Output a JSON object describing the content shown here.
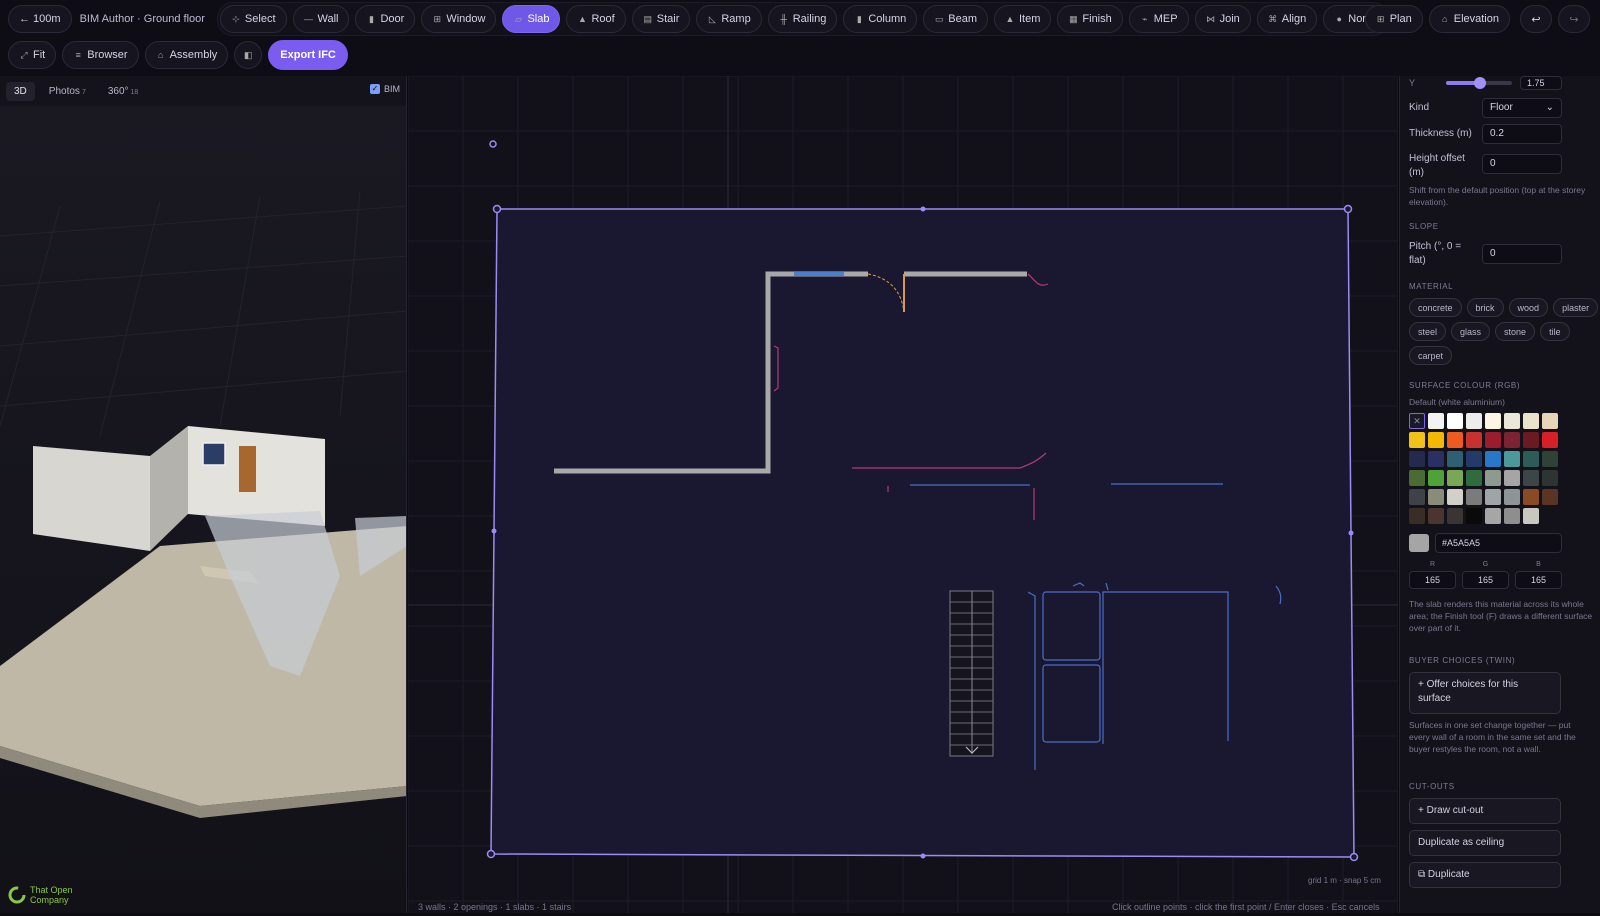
{
  "toolbar": {
    "back_label": "← 100m",
    "title": "BIM Author · Ground floor",
    "tools": [
      {
        "icon": "⊹",
        "label": "Select"
      },
      {
        "icon": "—",
        "label": "Wall"
      },
      {
        "icon": "▮",
        "label": "Door"
      },
      {
        "icon": "⊞",
        "label": "Window"
      },
      {
        "icon": "▱",
        "label": "Slab"
      },
      {
        "icon": "▲",
        "label": "Roof"
      },
      {
        "icon": "▤",
        "label": "Stair"
      },
      {
        "icon": "◺",
        "label": "Ramp"
      },
      {
        "icon": "╫",
        "label": "Railing"
      },
      {
        "icon": "▮",
        "label": "Column"
      },
      {
        "icon": "▭",
        "label": "Beam"
      },
      {
        "icon": "▲",
        "label": "Item"
      },
      {
        "icon": "▦",
        "label": "Finish"
      },
      {
        "icon": "⌁",
        "label": "MEP"
      },
      {
        "icon": "⋈",
        "label": "Join"
      },
      {
        "icon": "⌘",
        "label": "Align"
      },
      {
        "icon": "●",
        "label": "North"
      }
    ],
    "active_tool": "Slab",
    "view_buttons": [
      {
        "icon": "⊞",
        "label": "Plan"
      },
      {
        "icon": "⌂",
        "label": "Elevation"
      }
    ],
    "undo_icon": "↩",
    "redo_icon": "↪",
    "row2": [
      {
        "icon": "⤢",
        "label": "Fit"
      },
      {
        "icon": "≡",
        "label": "Browser"
      },
      {
        "icon": "⌂",
        "label": "Assembly"
      },
      {
        "icon": "◧",
        "label": ""
      }
    ],
    "export_label": "Export IFC"
  },
  "left_panel": {
    "tabs": [
      {
        "label": "3D",
        "count": ""
      },
      {
        "label": "Photos",
        "count": "7"
      },
      {
        "label": "360°",
        "count": "18"
      }
    ],
    "bim_label": "BIM",
    "logo_line1": "That Open",
    "logo_line2": "Company"
  },
  "canvas": {
    "grid_label": "grid 1 m · snap 5 cm",
    "status_left": "3 walls · 2 openings · 1 slabs · 1 stairs",
    "status_right": "Click outline points · click the first point / Enter closes · Esc cancels"
  },
  "inspector": {
    "y_label": "Y",
    "y_value": "1.75",
    "y_fraction": 0.5,
    "kind_label": "Kind",
    "kind_value": "Floor",
    "thickness_label": "Thickness (m)",
    "thickness_value": "0.2",
    "height_offset_label": "Height offset (m)",
    "height_offset_value": "0",
    "height_offset_hint": "Shift from the default position (top at the storey elevation).",
    "slope_section": "SLOPE",
    "pitch_label": "Pitch (°, 0 = flat)",
    "pitch_value": "0",
    "material_section": "MATERIAL",
    "materials": [
      "concrete",
      "brick",
      "wood",
      "plaster",
      "steel",
      "glass",
      "stone",
      "tile",
      "carpet"
    ],
    "surface_section": "SURFACE COLOUR (RGB)",
    "surface_default": "Default (white aluminium)",
    "swatches": [
      "none",
      "#f2f2f2",
      "#ffffff",
      "#ececec",
      "#fdf6e3",
      "#ece8d8",
      "#ebe3c8",
      "#e6d5b8",
      "#f2c21b",
      "#f5b800",
      "#f05a1e",
      "#c8322d",
      "#9b1c2c",
      "#7c2230",
      "#6b1a22",
      "#d61f26",
      "#232a4e",
      "#2a2f64",
      "#2e5f73",
      "#243a6b",
      "#2878c8",
      "#4a9a9c",
      "#2d5b57",
      "#2e4238",
      "#4b6b34",
      "#4fa23a",
      "#79a854",
      "#2f6b3e",
      "#8d9a8e",
      "#a5a5a5",
      "#3d4646",
      "#2c3434",
      "#3f4248",
      "#8a8c7a",
      "#d2d0c8",
      "#7b7b7b",
      "#9ea4a8",
      "#8e9498",
      "#8a4a24",
      "#5a3424",
      "#3a2e24",
      "#4a3530",
      "#3a3434",
      "#0a0a0a",
      "#a6a6a6",
      "#8e8e8e",
      "#c8c8c0"
    ],
    "hex_value": "#A5A5A5",
    "r_label": "R",
    "r_value": "165",
    "g_label": "G",
    "g_value": "165",
    "b_label": "B",
    "b_value": "165",
    "material_hint": "The slab renders this material across its whole area; the Finish tool (F) draws a different surface over part of it.",
    "buyer_section": "BUYER CHOICES (TWIN)",
    "offer_button": "+ Offer choices for this surface",
    "buyer_hint": "Surfaces in one set change together — put every wall of a room in the same set and the buyer restyles the room, not a wall.",
    "cutouts_section": "CUT-OUTS",
    "draw_cutout_button": "+ Draw cut-out",
    "duplicate_ceiling_button": "Duplicate as ceiling",
    "duplicate_button": "⧉ Duplicate"
  },
  "colors": {
    "accent": "#7b5cf0",
    "outline": "#9b8cf5",
    "wall": "#a8a8a8",
    "window": "#4a7fd0",
    "door": "#d89a4a"
  }
}
